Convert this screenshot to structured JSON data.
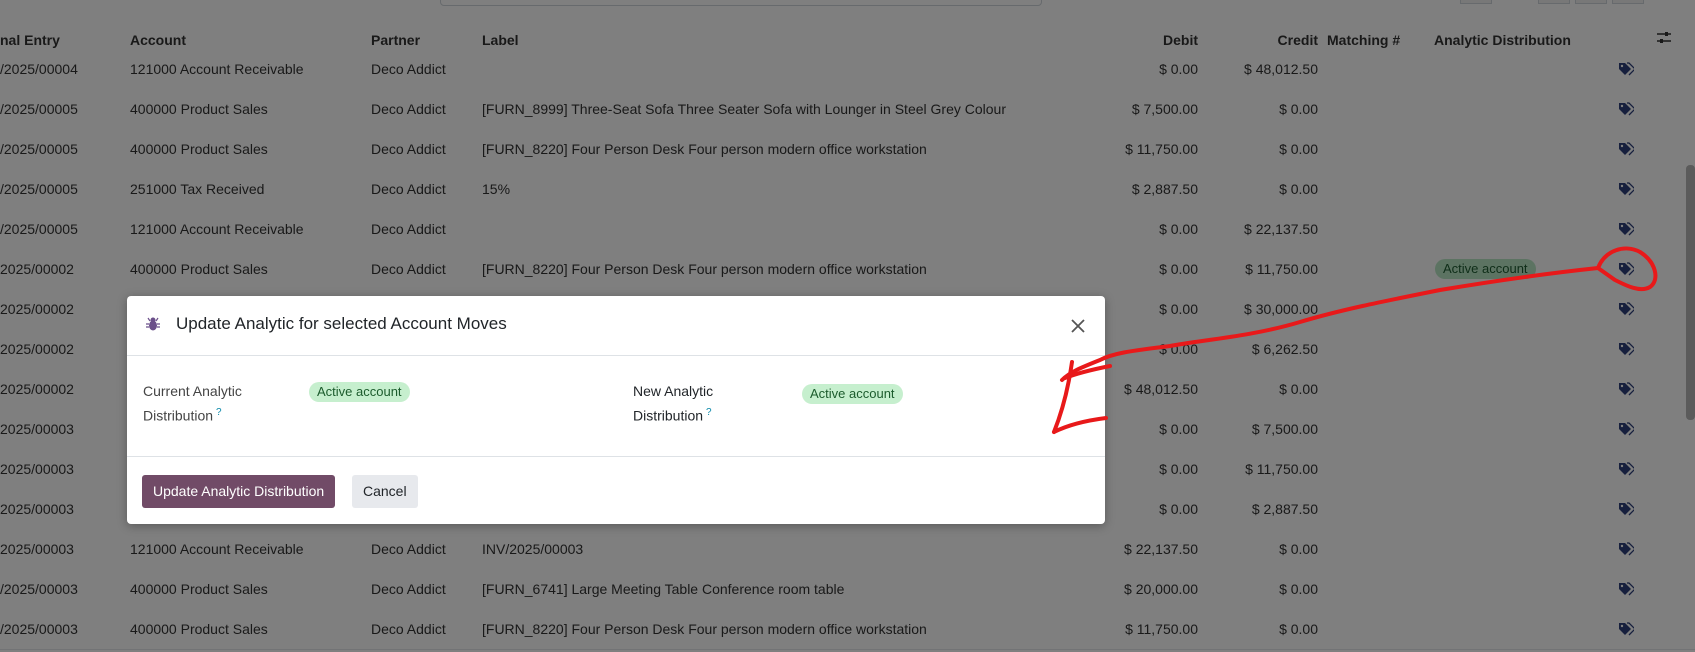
{
  "table": {
    "headers": {
      "journal_entry": "nal Entry",
      "account": "Account",
      "partner": "Partner",
      "label": "Label",
      "debit": "Debit",
      "credit": "Credit",
      "matching": "Matching #",
      "analytic": "Analytic Distribution"
    },
    "rows": [
      {
        "entry": "/2025/00004",
        "account": "121000 Account Receivable",
        "partner": "Deco Addict",
        "label": "",
        "debit": "$ 0.00",
        "credit": "$ 48,012.50",
        "analytic": ""
      },
      {
        "entry": "/2025/00005",
        "account": "400000 Product Sales",
        "partner": "Deco Addict",
        "label": "[FURN_8999] Three-Seat Sofa Three Seater Sofa with Lounger in Steel Grey Colour",
        "debit": "$ 7,500.00",
        "credit": "$ 0.00",
        "analytic": ""
      },
      {
        "entry": "/2025/00005",
        "account": "400000 Product Sales",
        "partner": "Deco Addict",
        "label": "[FURN_8220] Four Person Desk Four person modern office workstation",
        "debit": "$ 11,750.00",
        "credit": "$ 0.00",
        "analytic": ""
      },
      {
        "entry": "/2025/00005",
        "account": "251000 Tax Received",
        "partner": "Deco Addict",
        "label": "15%",
        "debit": "$ 2,887.50",
        "credit": "$ 0.00",
        "analytic": ""
      },
      {
        "entry": "/2025/00005",
        "account": "121000 Account Receivable",
        "partner": "Deco Addict",
        "label": "",
        "debit": "$ 0.00",
        "credit": "$ 22,137.50",
        "analytic": ""
      },
      {
        "entry": "2025/00002",
        "account": "400000 Product Sales",
        "partner": "Deco Addict",
        "label": "[FURN_8220] Four Person Desk Four person modern office workstation",
        "debit": "$ 0.00",
        "credit": "$ 11,750.00",
        "analytic": "Active account"
      },
      {
        "entry": "2025/00002",
        "account": "",
        "partner": "",
        "label": "",
        "debit": "$ 0.00",
        "credit": "$ 30,000.00",
        "analytic": ""
      },
      {
        "entry": "2025/00002",
        "account": "",
        "partner": "",
        "label": "",
        "debit": "$ 0.00",
        "credit": "$ 6,262.50",
        "analytic": ""
      },
      {
        "entry": "2025/00002",
        "account": "",
        "partner": "",
        "label": "",
        "debit": "$ 48,012.50",
        "credit": "$ 0.00",
        "analytic": ""
      },
      {
        "entry": "2025/00003",
        "account": "",
        "partner": "",
        "label": "",
        "debit": "$ 0.00",
        "credit": "$ 7,500.00",
        "analytic": ""
      },
      {
        "entry": "2025/00003",
        "account": "",
        "partner": "",
        "label": "",
        "debit": "$ 0.00",
        "credit": "$ 11,750.00",
        "analytic": ""
      },
      {
        "entry": "2025/00003",
        "account": "",
        "partner": "",
        "label": "",
        "debit": "$ 0.00",
        "credit": "$ 2,887.50",
        "analytic": ""
      },
      {
        "entry": "2025/00003",
        "account": "121000 Account Receivable",
        "partner": "Deco Addict",
        "label": "INV/2025/00003",
        "debit": "$ 22,137.50",
        "credit": "$ 0.00",
        "analytic": ""
      },
      {
        "entry": "/2025/00003",
        "account": "400000 Product Sales",
        "partner": "Deco Addict",
        "label": "[FURN_6741] Large Meeting Table Conference room table",
        "debit": "$ 20,000.00",
        "credit": "$ 0.00",
        "analytic": ""
      },
      {
        "entry": "/2025/00003",
        "account": "400000 Product Sales",
        "partner": "Deco Addict",
        "label": "[FURN_8220] Four Person Desk Four person modern office workstation",
        "debit": "$ 11,750.00",
        "credit": "$ 0.00",
        "analytic": ""
      }
    ]
  },
  "dialog": {
    "title": "Update Analytic for selected Account Moves",
    "current_label_line1": "Current Analytic",
    "current_label_line2": "Distribution",
    "current_value": "Active account",
    "new_label_line1": "New Analytic",
    "new_label_line2": "Distribution",
    "new_value": "Active account",
    "help_mark": "?",
    "primary_button": "Update Analytic Distribution",
    "cancel_button": "Cancel"
  },
  "icons": {
    "close": "close-icon",
    "bug": "bug-icon",
    "tag": "tags-icon",
    "optional_columns": "sliders-icon"
  },
  "colors": {
    "primary": "#714b67",
    "badge_bg": "#c6efce",
    "annotation": "#e8191a"
  }
}
